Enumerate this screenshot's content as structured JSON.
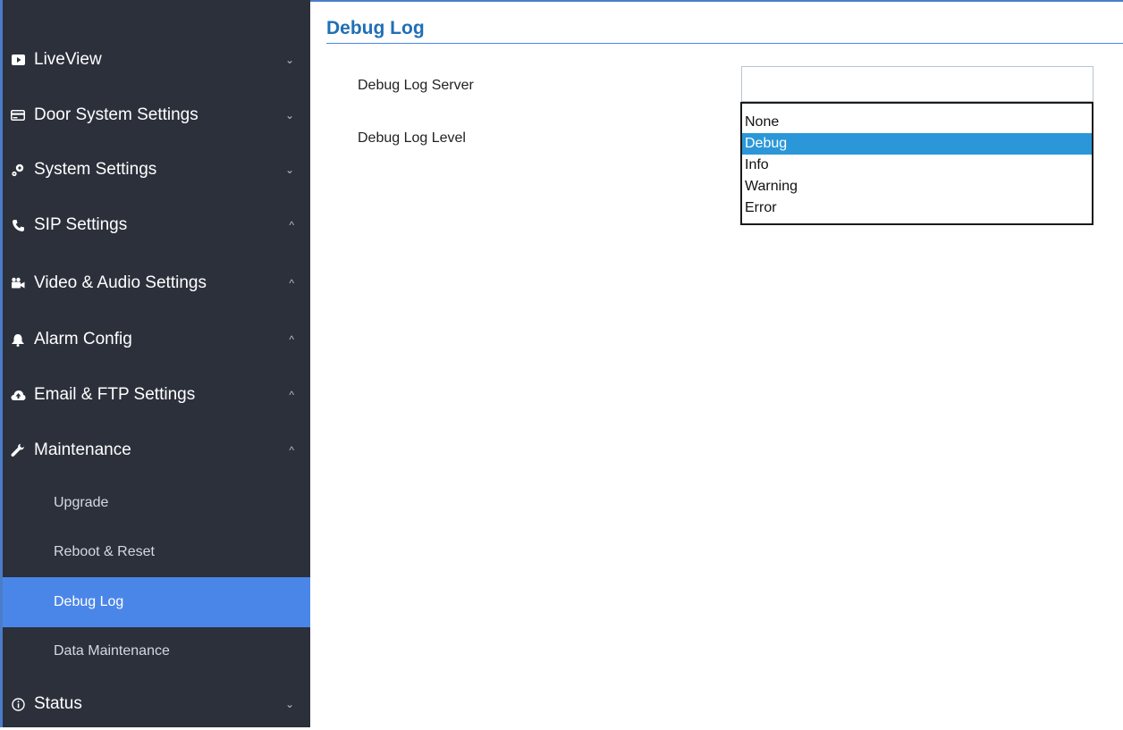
{
  "sidebar": {
    "items": [
      {
        "label": "LiveView",
        "icon": "video-play-icon",
        "expanded": false
      },
      {
        "label": "Door System Settings",
        "icon": "card-icon",
        "expanded": false
      },
      {
        "label": "System Settings",
        "icon": "gears-icon",
        "expanded": false
      },
      {
        "label": "SIP Settings",
        "icon": "phone-icon",
        "expanded": true
      },
      {
        "label": "Video & Audio Settings",
        "icon": "camera-icon",
        "expanded": true
      },
      {
        "label": "Alarm Config",
        "icon": "bell-icon",
        "expanded": true
      },
      {
        "label": "Email & FTP Settings",
        "icon": "cloud-upload-icon",
        "expanded": true
      },
      {
        "label": "Maintenance",
        "icon": "wrench-icon",
        "expanded": true
      },
      {
        "label": "Status",
        "icon": "info-circle-icon",
        "expanded": false
      }
    ],
    "maintenance_sub": [
      {
        "label": "Upgrade"
      },
      {
        "label": "Reboot & Reset"
      },
      {
        "label": "Debug Log",
        "active": true
      },
      {
        "label": "Data Maintenance"
      }
    ]
  },
  "main": {
    "title": "Debug Log",
    "fields": {
      "server_label": "Debug Log Server",
      "server_value": "",
      "level_label": "Debug Log Level"
    },
    "level_options": [
      "None",
      "Debug",
      "Info",
      "Warning",
      "Error"
    ],
    "level_selected": "Debug"
  },
  "colors": {
    "sidebar_bg": "#2b303b",
    "active_item": "#4a86e8",
    "title": "#1f6fb6",
    "option_highlight": "#2b97d8"
  }
}
